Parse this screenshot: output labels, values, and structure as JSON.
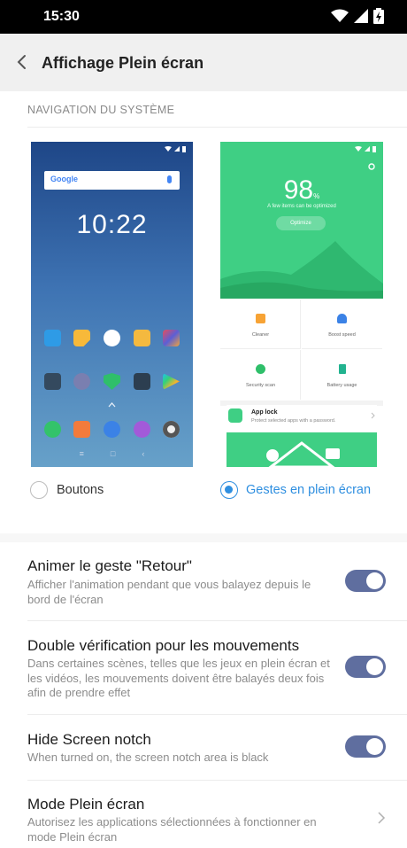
{
  "status_bar": {
    "time": "15:30",
    "icons": [
      "wifi-icon",
      "signal-icon",
      "battery-charging-icon"
    ]
  },
  "app_bar": {
    "title": "Affichage Plein écran",
    "back_icon": "back-arrow-icon"
  },
  "navigation": {
    "section_label": "NAVIGATION DU SYSTÈME",
    "left_preview": {
      "search_label": "Google",
      "clock": "10:22"
    },
    "right_preview": {
      "score": "98",
      "score_unit": "%",
      "score_caption": "A few items can be optimized",
      "optimize_button": "Optimize",
      "tiles": [
        "Cleaner",
        "Boost speed",
        "Security scan",
        "Battery usage"
      ],
      "app_lock_title": "App lock",
      "app_lock_desc": "Protect selected apps with a password."
    },
    "options": [
      {
        "label": "Boutons",
        "selected": false
      },
      {
        "label": "Gestes en plein écran",
        "selected": true
      }
    ]
  },
  "settings": [
    {
      "title": "Animer le geste \"Retour\"",
      "description": "Afficher l'animation pendant que vous balayez depuis le bord de l'écran",
      "control": "toggle",
      "on": true
    },
    {
      "title": "Double vérification pour les mouvements",
      "description": "Dans certaines scènes, telles que les jeux en plein écran et les vidéos, les mouvements doivent être balayés deux fois afin de prendre effet",
      "control": "toggle",
      "on": true
    },
    {
      "title": "Hide Screen notch",
      "description": "When turned on, the screen notch area is black",
      "control": "toggle",
      "on": true
    },
    {
      "title": "Mode Plein écran",
      "description": "Autorisez les applications sélectionnées à fonctionner en mode Plein écran",
      "control": "chevron"
    }
  ],
  "colors": {
    "accent": "#2f8fe0",
    "toggle_on": "#5f6e9f",
    "preview_green": "#3fcf84"
  }
}
